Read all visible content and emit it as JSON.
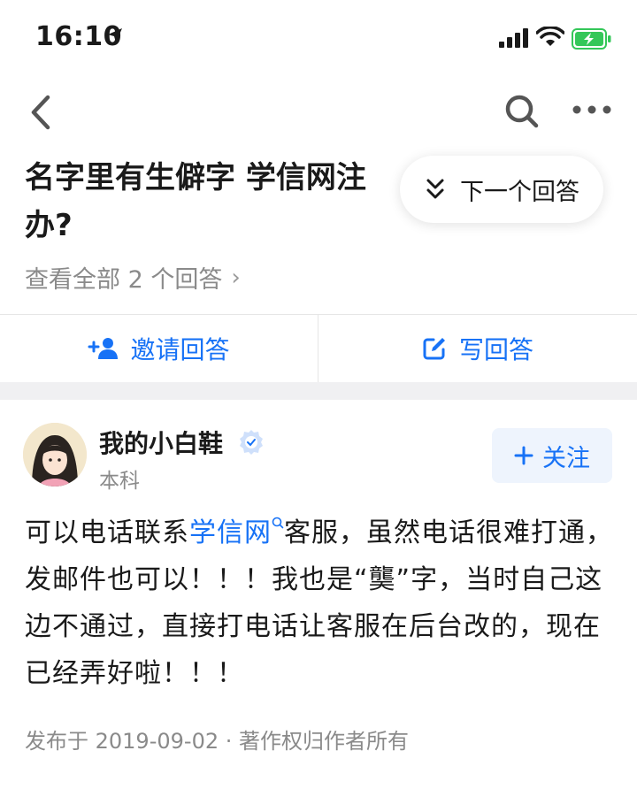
{
  "status_bar": {
    "time": "16:10"
  },
  "nav": {},
  "question": {
    "title_line1": "名字里有生僻字 学信网注",
    "title_line2": "办?",
    "view_all": "查看全部 2 个回答"
  },
  "next_answer": {
    "label": "下一个回答"
  },
  "actions": {
    "invite": "邀请回答",
    "write": "写回答"
  },
  "answer": {
    "author": {
      "name": "我的小白鞋",
      "subtitle": "本科"
    },
    "follow_label": "关注",
    "text_before": "可以电话联系",
    "link_text": "学信网",
    "text_after": "客服，虽然电话很难打通，发邮件也可以！！！我也是“龑”字，当时自己这边不通过，直接打电话让客服在后台改的，现在已经弄好啦！！！",
    "meta": "发布于 2019-09-02 · 著作权归作者所有"
  },
  "colors": {
    "accent": "#1772f6",
    "muted": "#8a8a8a",
    "battery": "#34c759"
  }
}
